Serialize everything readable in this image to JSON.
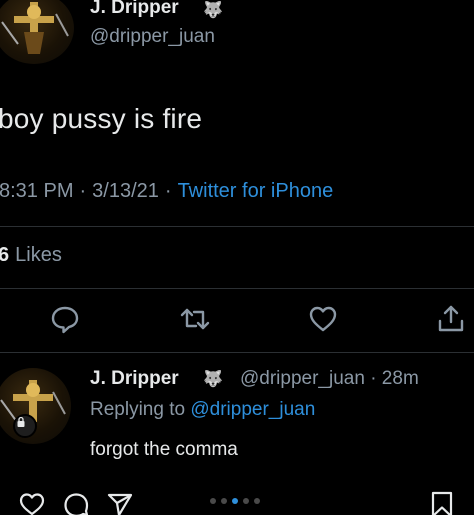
{
  "tweet": {
    "author_name": "J. Dripper",
    "author_emoji": "🐺",
    "author_handle": "@dripper_juan",
    "text": "boy pussy is fire",
    "time": "8:31 PM",
    "date": "3/13/21",
    "source": "Twitter for iPhone",
    "likes_count": "6",
    "likes_label": "Likes"
  },
  "actions": {
    "reply_icon": "comment-icon",
    "retweet_icon": "retweet-icon",
    "like_icon": "heart-icon",
    "share_icon": "share-icon"
  },
  "reply": {
    "author_name": "J. Dripper",
    "author_emoji": "🐺",
    "handle_time": "@dripper_juan · 28m",
    "replying_prefix": "Replying to",
    "replying_handle": "@dripper_juan",
    "text": "forgot the comma"
  },
  "instagram_bar": {
    "icons": [
      "heart-icon",
      "comment-icon",
      "send-icon",
      "bookmark-icon"
    ],
    "carousel_dots": 5,
    "active_dot": 2
  },
  "colors": {
    "background": "#000000",
    "text": "#e7e9ea",
    "muted": "#8b98a5",
    "link": "#2e8fdb"
  }
}
